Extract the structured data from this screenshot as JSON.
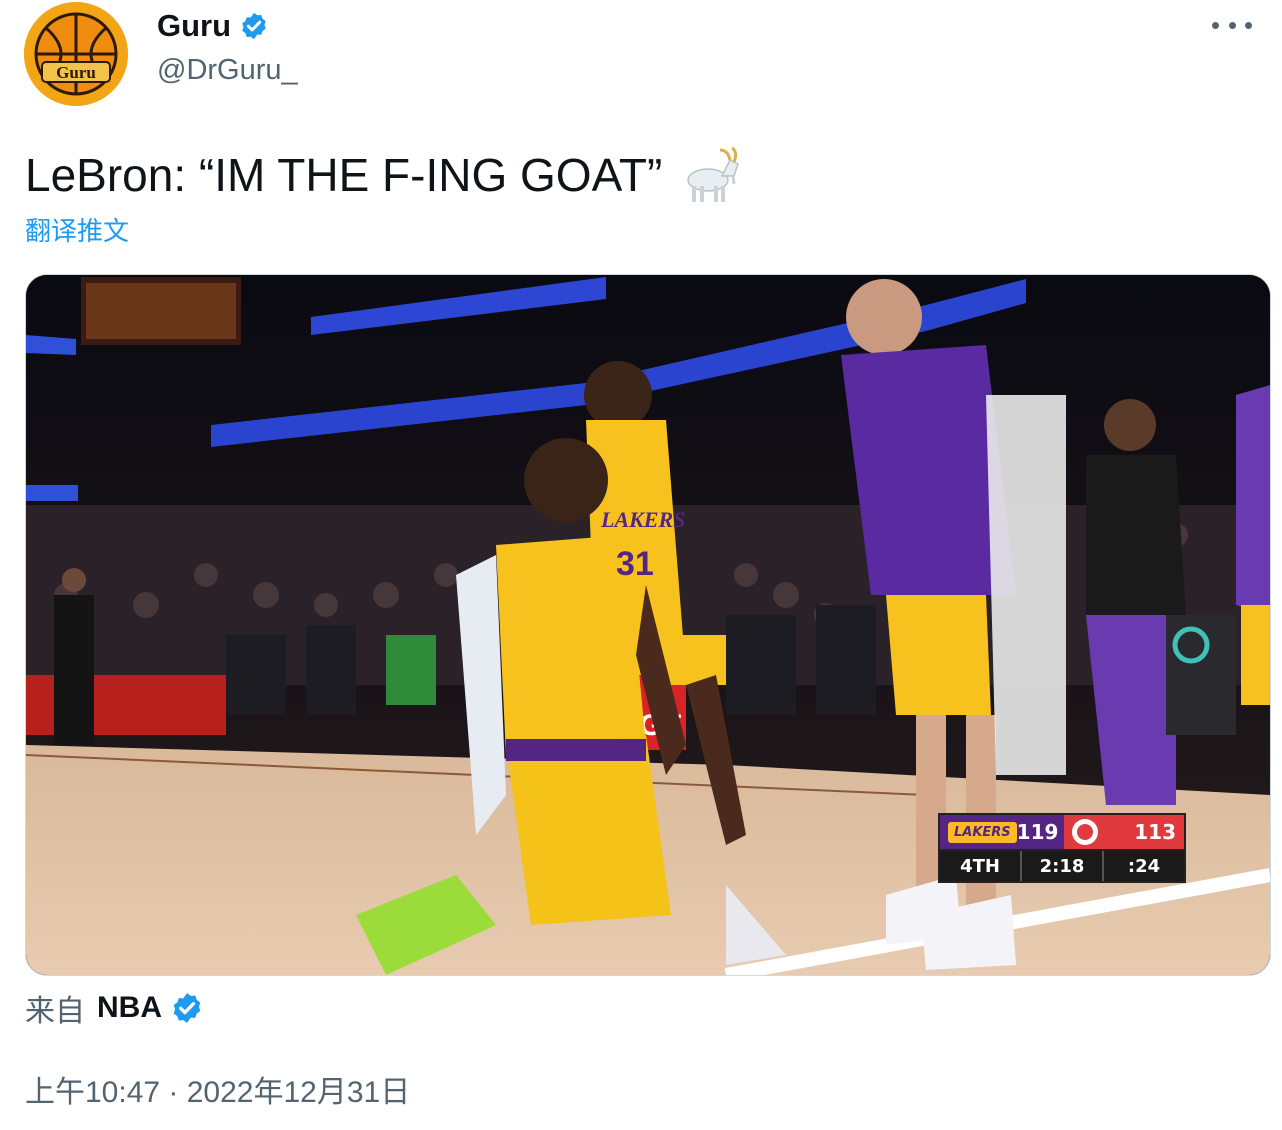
{
  "author": {
    "display_name": "Guru",
    "handle": "@DrGuru_",
    "avatar_text": "Guru",
    "verified": true
  },
  "tweet": {
    "text": "LeBron: “IM THE F-ING GOAT”",
    "emoji_icon": "goat-icon",
    "translate_label": "翻译推文"
  },
  "media": {
    "scoreboard": {
      "team1": "LAKERS",
      "team1_score": "119",
      "team2_score": "113",
      "quarter": "4TH",
      "game_clock": "2:18",
      "shot_clock": ":24"
    },
    "jersey_text": "LAKERS",
    "jersey_number": "31"
  },
  "source": {
    "via_label": "来自",
    "name": "NBA",
    "verified": true
  },
  "timestamp": "上午10:47 · 2022年12月31日",
  "colors": {
    "link_blue": "#1d9bf0",
    "text_primary": "#0f1419",
    "text_secondary": "#536471",
    "lakers_purple": "#552583",
    "lakers_gold": "#fdb927",
    "hawks_red": "#e03a3e"
  }
}
